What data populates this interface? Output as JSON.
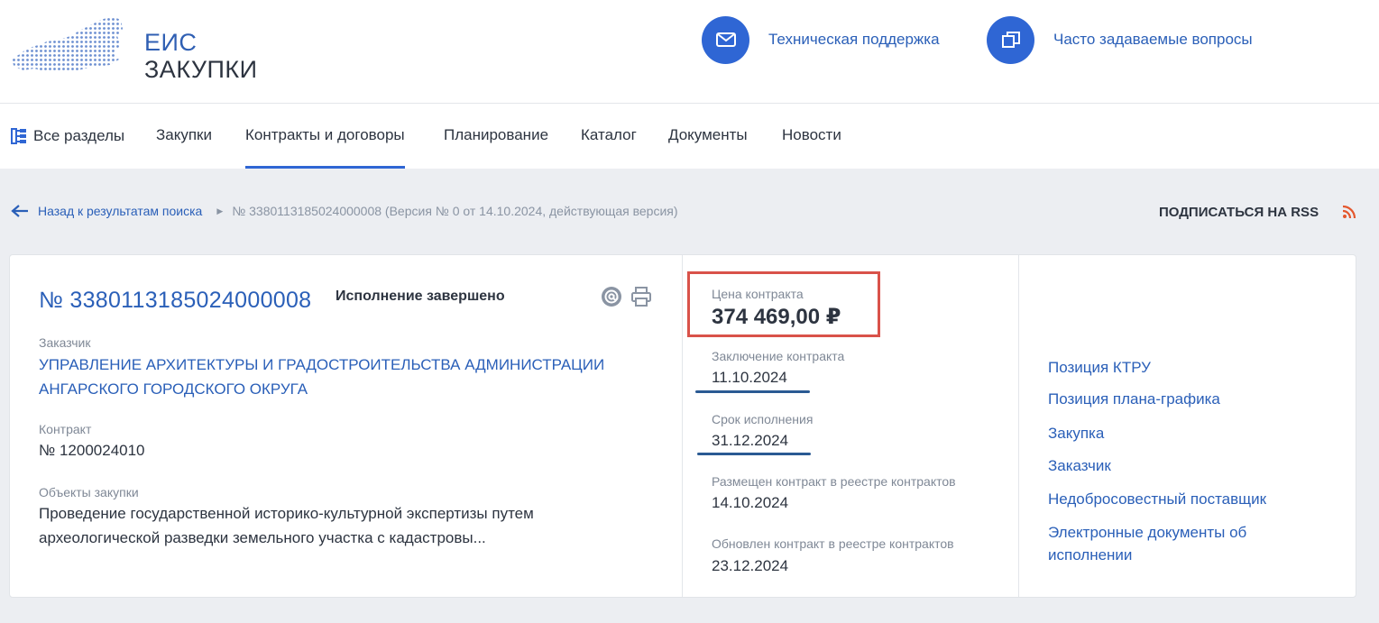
{
  "header": {
    "logo_line1": "ЕИС",
    "logo_line2": "ЗАКУПКИ",
    "support_label": "Техническая поддержка",
    "faq_label": "Часто задаваемые вопросы"
  },
  "nav": {
    "items": [
      {
        "label": "Все разделы"
      },
      {
        "label": "Закупки"
      },
      {
        "label": "Контракты и договоры"
      },
      {
        "label": "Планирование"
      },
      {
        "label": "Каталог"
      },
      {
        "label": "Документы"
      },
      {
        "label": "Новости"
      }
    ]
  },
  "breadcrumb": {
    "back_label": "Назад к результатам поиска",
    "current": "№ 3380113185024000008 (Версия № 0 от 14.10.2024, действующая версия)"
  },
  "rss_label": "ПОДПИСАТЬСЯ НА RSS",
  "colors": {
    "accent": "#2f66d4",
    "link": "#2a5fb8",
    "highlight_box": "#d9524a",
    "underline": "#2a5a93",
    "rss": "#e4572e"
  },
  "contract": {
    "number": "№ 3380113185024000008",
    "status": "Исполнение завершено",
    "customer_label": "Заказчик",
    "customer_line1": "УПРАВЛЕНИЕ АРХИТЕКТУРЫ И ГРАДОСТРОИТЕЛЬСТВА АДМИНИСТРАЦИИ",
    "customer_line2": "АНГАРСКОГО ГОРОДСКОГО ОКРУГА",
    "contract_label": "Контракт",
    "contract_value": "№ 1200024010",
    "objects_label": "Объекты закупки",
    "objects_line1": "Проведение государственной историко-культурной экспертизы путем",
    "objects_line2": "археологической разведки земельного участка с кадастровы..."
  },
  "details": {
    "price_label": "Цена контракта",
    "price_value": "374 469,00 ₽",
    "conclusion_label": "Заключение контракта",
    "conclusion_value": "11.10.2024",
    "term_label": "Срок исполнения",
    "term_value": "31.12.2024",
    "placed_label": "Размещен контракт в реестре контрактов",
    "placed_value": "14.10.2024",
    "updated_label": "Обновлен контракт в реестре контрактов",
    "updated_value": "23.12.2024"
  },
  "links": [
    {
      "label": "Позиция КТРУ"
    },
    {
      "label": "Позиция плана-графика"
    },
    {
      "label": "Закупка"
    },
    {
      "label": "Заказчик"
    },
    {
      "label": "Недобросовестный поставщик"
    },
    {
      "label": "Электронные документы об"
    },
    {
      "label": "исполнении"
    }
  ]
}
